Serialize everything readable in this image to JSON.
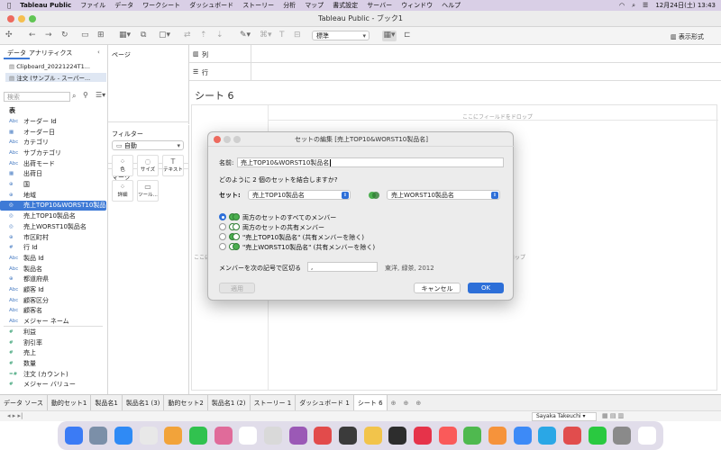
{
  "menubar": {
    "app": "Tableau Public",
    "items": [
      "ファイル",
      "データ",
      "ワークシート",
      "ダッシュボード",
      "ストーリー",
      "分析",
      "マップ",
      "書式設定",
      "サーバー",
      "ウィンドウ",
      "ヘルプ"
    ],
    "datetime": "12月24日(土)  13:43"
  },
  "window": {
    "title": "Tableau Public - ブック1"
  },
  "toolbar": {
    "marks_standard": "標準",
    "show_me": "表示形式"
  },
  "left": {
    "tab_data": "データ",
    "tab_analytics": "アナリティクス",
    "datasource1": "Clipboard_20221224T1...",
    "datasource2": "注文 (サンプル - スーパー...",
    "search_placeholder": "検索",
    "section_table": "表",
    "fields": [
      {
        "icon": "Abc",
        "label": "オーダー Id",
        "g": false
      },
      {
        "icon": "▦",
        "label": "オーダー日",
        "g": false
      },
      {
        "icon": "Abc",
        "label": "カテゴリ",
        "g": false
      },
      {
        "icon": "Abc",
        "label": "サブカテゴリ",
        "g": false
      },
      {
        "icon": "Abc",
        "label": "出荷モード",
        "g": false
      },
      {
        "icon": "▦",
        "label": "出荷日",
        "g": false
      },
      {
        "icon": "⊕",
        "label": "国",
        "g": false
      },
      {
        "icon": "⊕",
        "label": "地域",
        "g": false
      },
      {
        "icon": "◎",
        "label": "売上TOP10&WORST10製品...",
        "g": false,
        "sel": true
      },
      {
        "icon": "◎",
        "label": "売上TOP10製品名",
        "g": false
      },
      {
        "icon": "◎",
        "label": "売上WORST10製品名",
        "g": false
      },
      {
        "icon": "⊕",
        "label": "市区町村",
        "g": false
      },
      {
        "icon": "#",
        "label": "行 Id",
        "g": false
      },
      {
        "icon": "Abc",
        "label": "製品 Id",
        "g": false
      },
      {
        "icon": "Abc",
        "label": "製品名",
        "g": false
      },
      {
        "icon": "⊕",
        "label": "都道府県",
        "g": false
      },
      {
        "icon": "Abc",
        "label": "顧客 Id",
        "g": false
      },
      {
        "icon": "Abc",
        "label": "顧客区分",
        "g": false
      },
      {
        "icon": "Abc",
        "label": "顧客名",
        "g": false
      },
      {
        "icon": "Abc",
        "label": "メジャー ネーム",
        "g": false
      },
      {
        "icon": "#",
        "label": "利益",
        "g": true
      },
      {
        "icon": "#",
        "label": "割引率",
        "g": true
      },
      {
        "icon": "#",
        "label": "売上",
        "g": true
      },
      {
        "icon": "#",
        "label": "数量",
        "g": true
      },
      {
        "icon": "=#",
        "label": "注文 (カウント)",
        "g": true
      },
      {
        "icon": "#",
        "label": "メジャー バリュー",
        "g": true
      }
    ]
  },
  "mid": {
    "pages": "ページ",
    "filters": "フィルター",
    "marks": "マーク",
    "mark_type": "自動",
    "mark_buttons": [
      "色",
      "サイズ",
      "テキスト",
      "詳細",
      "ツール..."
    ]
  },
  "shelves": {
    "columns": "列",
    "rows": "行"
  },
  "view": {
    "sheet_title": "シート 6",
    "drop_field": "ここにフィールドをドロップ",
    "drop_left": "ここに",
    "drop_right": "ロップ"
  },
  "dialog": {
    "title": "セットの編集 [売上TOP10&WORST10製品名]",
    "name_label": "名前:",
    "name_value": "売上TOP10&WORST10製品名",
    "question": "どのように 2 個のセットを結合しますか?",
    "set_label": "セット:",
    "set1": "売上TOP10製品名",
    "set2": "売上WORST10製品名",
    "options": [
      "両方のセットのすべてのメンバー",
      "両方のセットの共有メンバー",
      "\"売上TOP10製品名\" (共有メンバーを除く)",
      "\"売上WORST10製品名\" (共有メンバーを除く)"
    ],
    "separator_label": "メンバーを次の記号で区切る",
    "separator_value": ",",
    "separator_example": "東洋, 緑茶, 2012",
    "apply": "適用",
    "cancel": "キャンセル",
    "ok": "OK"
  },
  "tabs": [
    "データ ソース",
    "動的セット1",
    "製品名1",
    "製品名1 (3)",
    "動的セット2",
    "製品名1 (2)",
    "ストーリー 1",
    "ダッシュボード 1",
    "シート 6"
  ],
  "status": {
    "user": "Sayaka Takeuchi"
  },
  "dock_count": 24
}
